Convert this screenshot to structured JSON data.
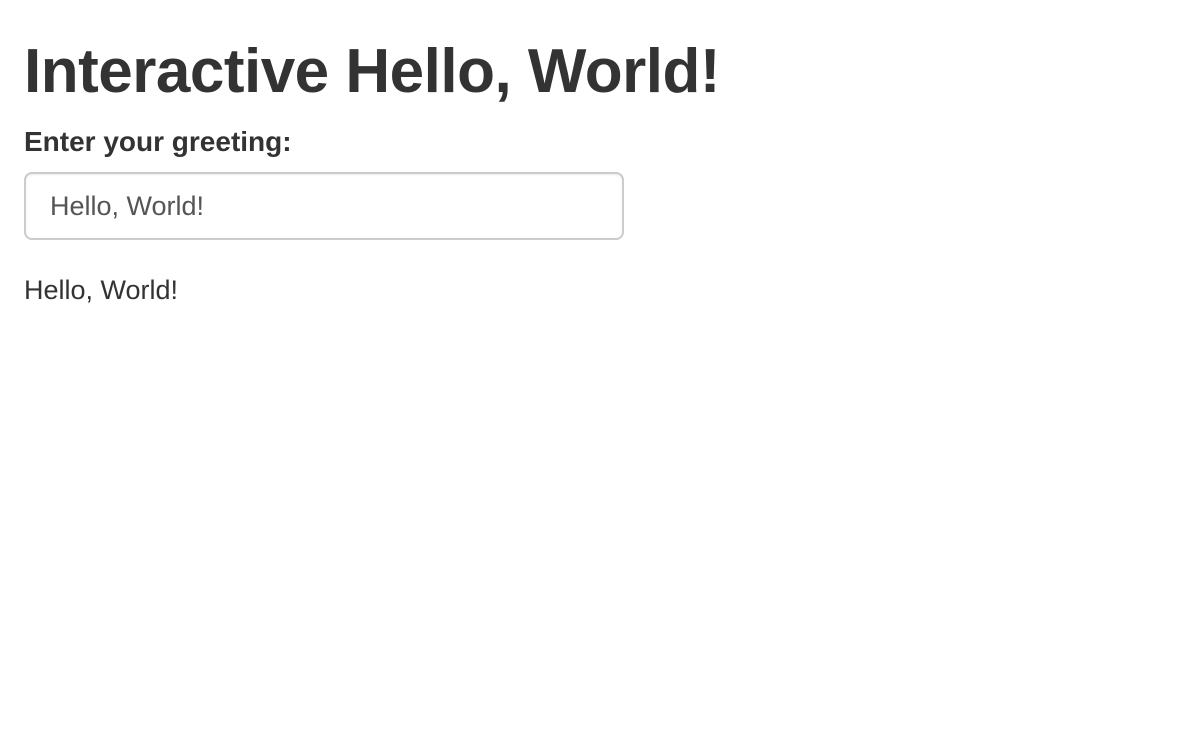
{
  "page": {
    "title": "Interactive Hello, World!"
  },
  "greeting_form": {
    "label": "Enter your greeting:",
    "input_value": "Hello, World!"
  },
  "output": {
    "text": "Hello, World!"
  }
}
